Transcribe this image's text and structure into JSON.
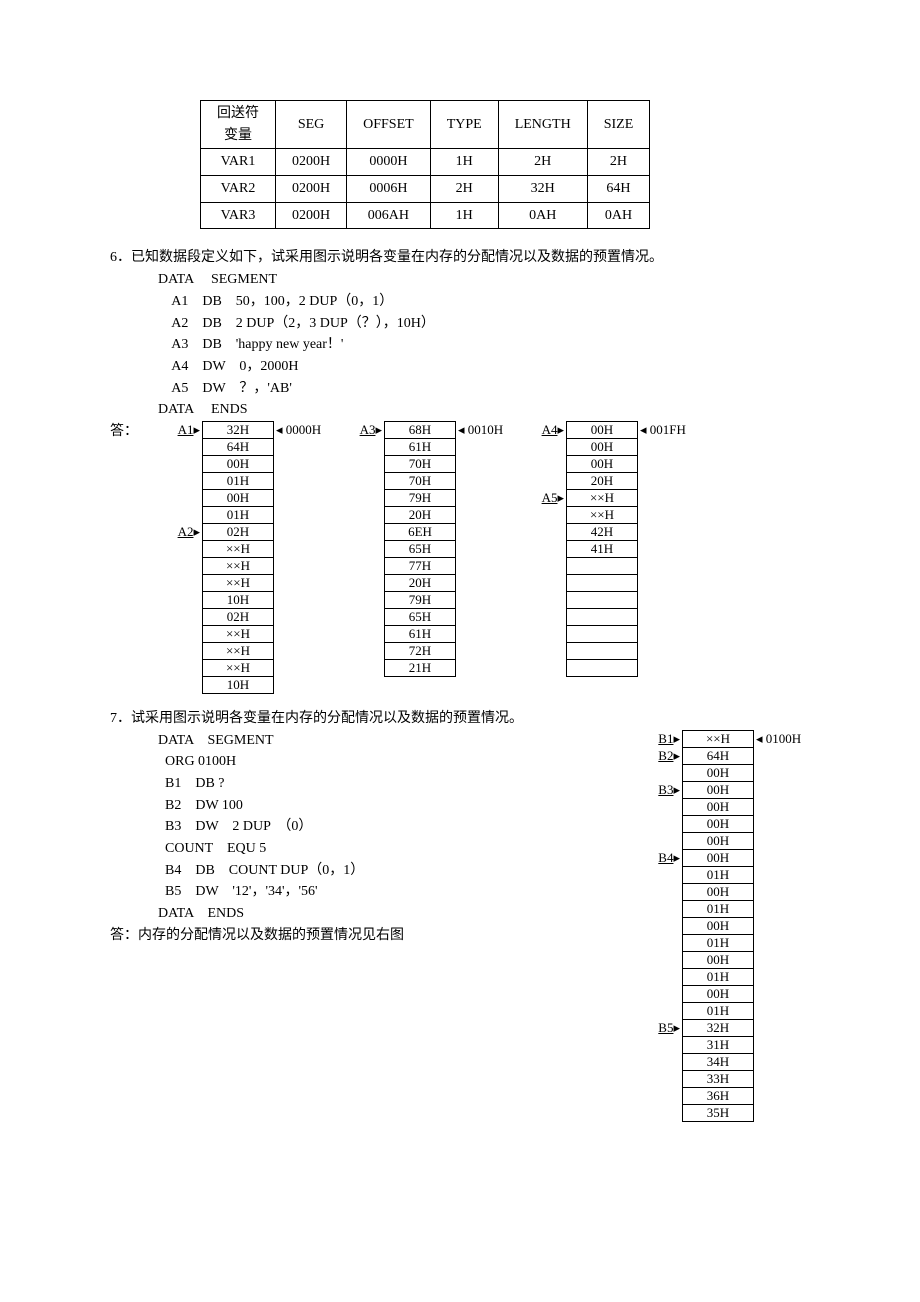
{
  "table1": {
    "header": [
      "回送符\n变量",
      "SEG",
      "OFFSET",
      "TYPE",
      "LENGTH",
      "SIZE"
    ],
    "rows": [
      [
        "VAR1",
        "0200H",
        "0000H",
        "1H",
        "2H",
        "2H"
      ],
      [
        "VAR2",
        "0200H",
        "0006H",
        "2H",
        "32H",
        "64H"
      ],
      [
        "VAR3",
        "0200H",
        "006AH",
        "1H",
        "0AH",
        "0AH"
      ]
    ]
  },
  "q6": {
    "num": "6．",
    "text": "已知数据段定义如下，试采用图示说明各变量在内存的分配情况以及数据的预置情况。",
    "code": [
      "DATA     SEGMENT",
      "    A1    DB    50，100，2 DUP（0，1）",
      "    A2    DB    2 DUP（2，3 DUP（？），10H）",
      "    A3    DB    'happy new year！'",
      "    A4    DW    0，2000H",
      "    A5    DW    ？，'AB'",
      "DATA     ENDS"
    ],
    "answer": "答：",
    "mem": {
      "col1": {
        "labels": [
          "A1",
          "",
          "",
          "",
          "",
          "",
          "A2",
          "",
          "",
          "",
          "",
          "",
          "",
          "",
          "",
          ""
        ],
        "cells": [
          "32H",
          "64H",
          "00H",
          "01H",
          "00H",
          "01H",
          "02H",
          "××H",
          "××H",
          "××H",
          "10H",
          "02H",
          "××H",
          "××H",
          "××H",
          "10H"
        ],
        "addr0": "0000H"
      },
      "col2": {
        "labels": [
          "A3",
          "",
          "",
          "",
          "",
          "",
          "",
          "",
          "",
          "",
          "",
          "",
          "",
          "",
          ""
        ],
        "cells": [
          "68H",
          "61H",
          "70H",
          "70H",
          "79H",
          "20H",
          "6EH",
          "65H",
          "77H",
          "20H",
          "79H",
          "65H",
          "61H",
          "72H",
          "21H"
        ],
        "addr0": "0010H"
      },
      "col3": {
        "labels": [
          "A4",
          "",
          "",
          "",
          "A5",
          "",
          "",
          ""
        ],
        "cells": [
          "00H",
          "00H",
          "00H",
          "20H",
          "××H",
          "××H",
          "42H",
          "41H"
        ],
        "blanks": 7,
        "addr0": "001FH"
      }
    }
  },
  "q7": {
    "num": "7．",
    "text": "试采用图示说明各变量在内存的分配情况以及数据的预置情况。",
    "code": [
      "DATA    SEGMENT",
      "  ORG 0100H",
      "  B1    DB ?",
      "  B2    DW 100",
      "  B3    DW    2 DUP  （0）",
      "  COUNT    EQU 5",
      "  B4    DB    COUNT DUP（0，1）",
      "  B5    DW    '12'，'34'，'56'",
      "DATA    ENDS"
    ],
    "answer": "答：内存的分配情况以及数据的预置情况见右图",
    "mem": {
      "labels": [
        "B1",
        "B2",
        "",
        "B3",
        "",
        "",
        "",
        "B4",
        "",
        "",
        "",
        "",
        "",
        "",
        "",
        "",
        "",
        "B5",
        "",
        "",
        "",
        "",
        ""
      ],
      "cells": [
        "××H",
        "64H",
        "00H",
        "00H",
        "00H",
        "00H",
        "00H",
        "00H",
        "01H",
        "00H",
        "01H",
        "00H",
        "01H",
        "00H",
        "01H",
        "00H",
        "01H",
        "32H",
        "31H",
        "34H",
        "33H",
        "36H",
        "35H"
      ],
      "addr0": "0100H"
    }
  },
  "chart_data": {
    "type": "table",
    "tables": [
      {
        "title": "回送符 变量属性表",
        "columns": [
          "变量",
          "SEG",
          "OFFSET",
          "TYPE",
          "LENGTH",
          "SIZE"
        ],
        "rows": [
          [
            "VAR1",
            "0200H",
            "0000H",
            "1H",
            "2H",
            "2H"
          ],
          [
            "VAR2",
            "0200H",
            "0006H",
            "2H",
            "32H",
            "64H"
          ],
          [
            "VAR3",
            "0200H",
            "006AH",
            "1H",
            "0AH",
            "0AH"
          ]
        ]
      }
    ],
    "memory_maps": [
      {
        "name": "Q6",
        "start": "0000H",
        "segments": {
          "A1": [
            "32H",
            "64H",
            "00H",
            "01H",
            "00H",
            "01H"
          ],
          "A2": [
            "02H",
            "××H",
            "××H",
            "××H",
            "10H",
            "02H",
            "××H",
            "××H",
            "××H",
            "10H"
          ],
          "A3": [
            "68H",
            "61H",
            "70H",
            "70H",
            "79H",
            "20H",
            "6EH",
            "65H",
            "77H",
            "20H",
            "79H",
            "65H",
            "61H",
            "72H",
            "21H"
          ],
          "A4": [
            "00H",
            "00H",
            "00H",
            "20H"
          ],
          "A5": [
            "××H",
            "××H",
            "42H",
            "41H"
          ]
        }
      },
      {
        "name": "Q7",
        "start": "0100H",
        "segments": {
          "B1": [
            "××H"
          ],
          "B2": [
            "64H",
            "00H"
          ],
          "B3": [
            "00H",
            "00H",
            "00H",
            "00H"
          ],
          "B4": [
            "00H",
            "01H",
            "00H",
            "01H",
            "00H",
            "01H",
            "00H",
            "01H",
            "00H",
            "01H"
          ],
          "B5": [
            "32H",
            "31H",
            "34H",
            "33H",
            "36H",
            "35H"
          ]
        }
      }
    ]
  }
}
